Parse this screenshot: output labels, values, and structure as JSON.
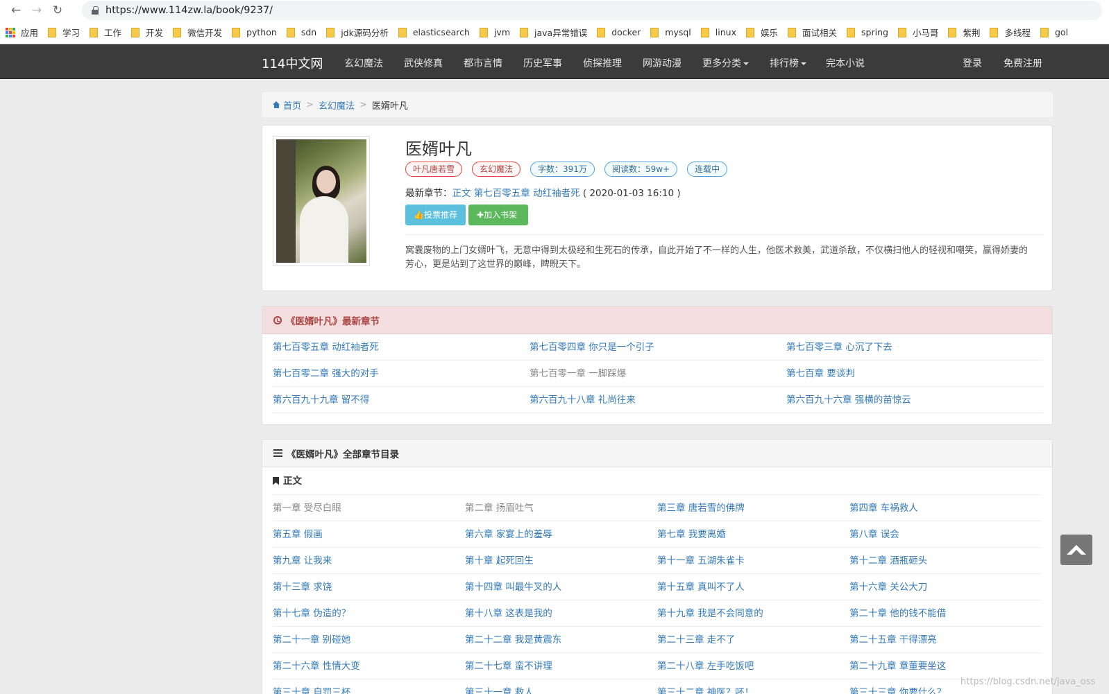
{
  "browser": {
    "url": "https://www.114zw.la/book/9237/",
    "bookmarks": [
      "应用",
      "学习",
      "工作",
      "开发",
      "微信开发",
      "python",
      "sdn",
      "jdk源码分析",
      "elasticsearch",
      "jvm",
      "java异常错误",
      "docker",
      "mysql",
      "linux",
      "娱乐",
      "面试相关",
      "spring",
      "小马哥",
      "紫荆",
      "多线程",
      "gol"
    ]
  },
  "nav": {
    "brand": "114中文网",
    "items": [
      "玄幻魔法",
      "武侠修真",
      "都市言情",
      "历史军事",
      "侦探推理",
      "网游动漫",
      "更多分类",
      "排行榜",
      "完本小说"
    ],
    "login": "登录",
    "register": "免费注册"
  },
  "breadcrumb": {
    "home": "首页",
    "category": "玄幻魔法",
    "current": "医婿叶凡"
  },
  "book": {
    "title": "医婿叶凡",
    "tags": [
      "叶凡唐若雪",
      "玄幻魔法",
      "字数：391万",
      "阅读数：59w+",
      "连载中"
    ],
    "latest_label": "最新章节：",
    "latest_volume": "正文",
    "latest_chapter": "第七百零五章 动红袖者死",
    "latest_time": "( 2020-01-03 16:10 )",
    "vote_button": "投票推荐",
    "shelf_button": "加入书架",
    "intro": "窝囊废物的上门女婿叶飞，无意中得到太极经和生死石的传承，自此开始了不一样的人生，他医术救美，武道杀敌，不仅横扫他人的轻视和嘲笑，赢得娇妻的芳心，更是站到了这世界的巅峰，睥睨天下。"
  },
  "latest_panel": {
    "title": "《医婿叶凡》最新章节",
    "chapters": [
      "第七百零五章 动红袖者死",
      "第七百零四章 你只是一个引子",
      "第七百零三章 心沉了下去",
      "第七百零二章 强大的对手",
      "第七百零一章 一脚踩爆",
      "第七百章 要谈判",
      "第六百九十九章 留不得",
      "第六百九十八章 礼尚往来",
      "第六百九十六章 强横的苗惊云"
    ]
  },
  "all_panel": {
    "title": "《医婿叶凡》全部章节目录",
    "volume": "正文",
    "chapters": [
      "第一章 受尽白眼",
      "第二章 扬眉吐气",
      "第三章 唐若雪的佛牌",
      "第四章 车祸救人",
      "第五章 假画",
      "第六章 家宴上的羞辱",
      "第七章 我要离婚",
      "第八章 误会",
      "第九章 让我来",
      "第十章 起死回生",
      "第十一章 五湖朱雀卡",
      "第十二章 酒瓶砸头",
      "第十三章 求饶",
      "第十四章 叫最牛叉的人",
      "第十五章 真叫不了人",
      "第十六章 关公大刀",
      "第十七章 伪造的？",
      "第十八章 这表是我的",
      "第十九章 我是不会同意的",
      "第二十章 他的钱不能借",
      "第二十一章 别碰她",
      "第二十二章 我是黄震东",
      "第二十三章 走不了",
      "第二十五章 干得漂亮",
      "第二十六章 性情大变",
      "第二十七章 蛮不讲理",
      "第二十八章 左手吃饭吧",
      "第二十九章 章董要坐这",
      "第三十章 自罚三杯",
      "第三十一章 救人",
      "第三十二章 神医？呸！",
      "第三十三章 你要什么？"
    ]
  },
  "watermark": "https://blog.csdn.net/java_oss"
}
